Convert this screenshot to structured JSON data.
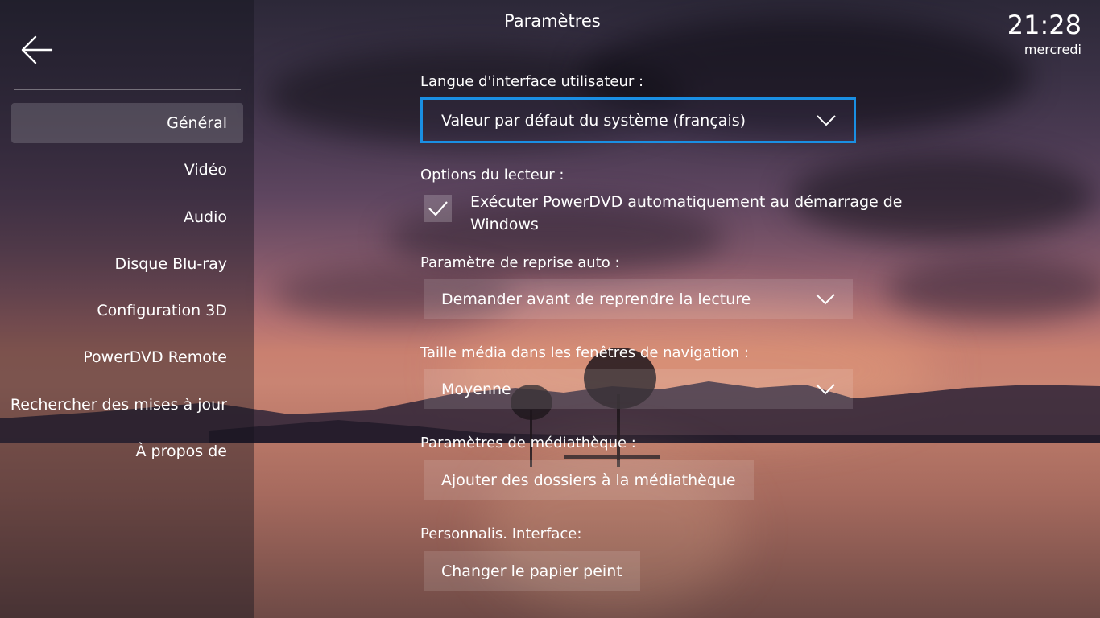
{
  "header": {
    "title": "Paramètres",
    "time": "21:28",
    "day": "mercredi"
  },
  "sidebar": {
    "back_icon": "arrow-left-icon",
    "items": [
      {
        "label": "Général",
        "active": true
      },
      {
        "label": "Vidéo",
        "active": false
      },
      {
        "label": "Audio",
        "active": false
      },
      {
        "label": "Disque Blu-ray",
        "active": false
      },
      {
        "label": "Configuration 3D",
        "active": false
      },
      {
        "label": "PowerDVD Remote",
        "active": false
      },
      {
        "label": "Rechercher des mises à jour",
        "active": false
      },
      {
        "label": "À propos de",
        "active": false
      }
    ]
  },
  "settings": {
    "language": {
      "label": "Langue d'interface utilisateur :",
      "value": "Valeur par défaut du système (français)"
    },
    "player_options": {
      "label": "Options du lecteur :",
      "autostart_label": "Exécuter PowerDVD automatiquement au démarrage de Windows",
      "autostart_checked": true
    },
    "auto_resume": {
      "label": "Paramètre de reprise auto :",
      "value": "Demander avant de reprendre la lecture"
    },
    "media_size": {
      "label": "Taille média dans les fenêtres de navigation :",
      "value": "Moyenne"
    },
    "library": {
      "label": "Paramètres de médiathèque :",
      "button": "Ajouter des dossiers à la médiathèque"
    },
    "customize": {
      "label": "Personnalis. Interface:",
      "button": "Changer le papier peint"
    }
  },
  "colors": {
    "focus_border": "#1a8fe3",
    "sidebar_overlay": "rgba(20,18,28,0.42)"
  }
}
